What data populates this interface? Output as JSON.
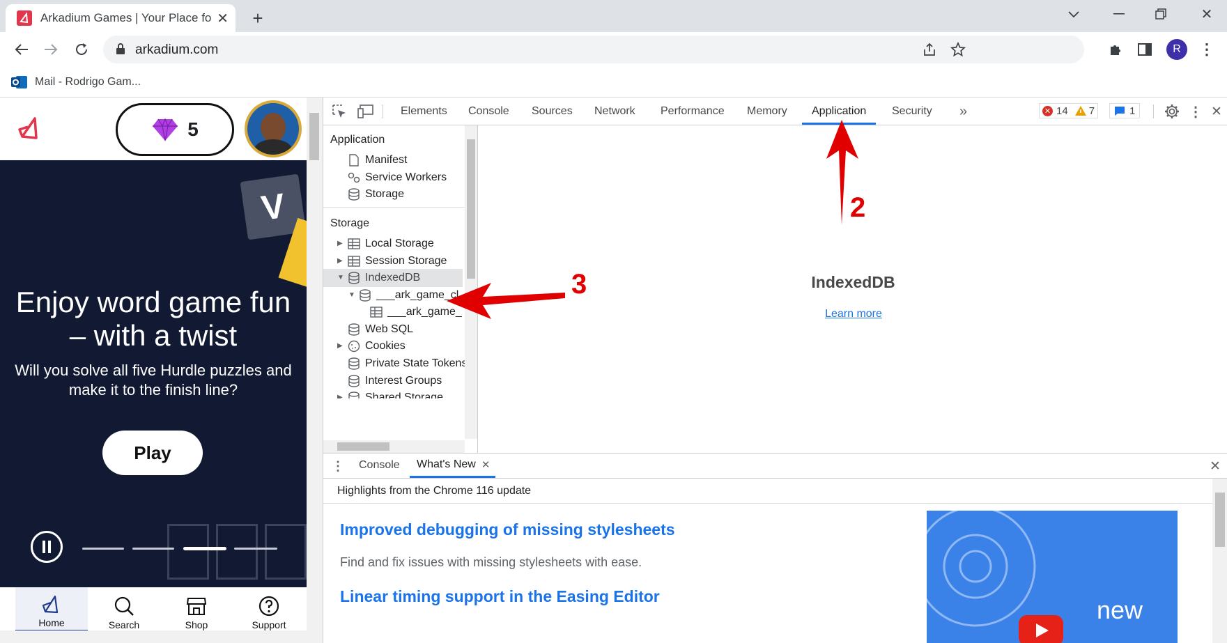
{
  "browser": {
    "tab_title": "Arkadium Games | Your Place for Games",
    "url": "arkadium.com",
    "profile_initial": "R",
    "bookmark": "Mail - Rodrigo Gam..."
  },
  "page": {
    "gems": "5",
    "hero_title": "Enjoy word game fun – with a twist",
    "hero_subtitle": "Will you solve all five Hurdle puzzles and make it to the finish line?",
    "tile_letter": "V",
    "play_label": "Play",
    "carousel_active_index": 3,
    "nav": [
      {
        "label": "Home",
        "icon": "home-icon"
      },
      {
        "label": "Search",
        "icon": "search-icon"
      },
      {
        "label": "Shop",
        "icon": "shop-icon"
      },
      {
        "label": "Support",
        "icon": "support-icon"
      }
    ]
  },
  "devtools": {
    "tabs": [
      "Elements",
      "Console",
      "Sources",
      "Network",
      "Performance",
      "Memory",
      "Application",
      "Security"
    ],
    "active_tab": "Application",
    "errors": "14",
    "warnings": "7",
    "infos": "1",
    "sidebar": {
      "application_header": "Application",
      "application_items": [
        "Manifest",
        "Service Workers",
        "Storage"
      ],
      "storage_header": "Storage",
      "storage_items": [
        "Local Storage",
        "Session Storage",
        "IndexedDB",
        "___ark_game_cl",
        "___ark_game_",
        "Web SQL",
        "Cookies",
        "Private State Tokens",
        "Interest Groups",
        "Shared Storage"
      ]
    },
    "main_title": "IndexedDB",
    "learn_more": "Learn more",
    "drawer": {
      "tabs": [
        "Console",
        "What's New"
      ],
      "highlight": "Highlights from the Chrome 116 update",
      "item1_title": "Improved debugging of missing stylesheets",
      "item1_desc": "Find and fix issues with missing stylesheets with ease.",
      "item2_title": "Linear timing support in the Easing Editor",
      "thumb_text": "new"
    }
  },
  "annotations": {
    "label2": "2",
    "label3": "3"
  },
  "colors": {
    "accent": "#1a73e8",
    "hero_bg": "#121a33",
    "arkadium_red": "#e1364b",
    "annotation_red": "#e00000"
  }
}
